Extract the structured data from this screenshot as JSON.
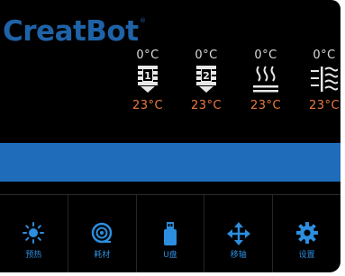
{
  "brand": {
    "logo_text": "CreatBot",
    "reg_mark": "®"
  },
  "temperatures": [
    {
      "id": "extruder-1",
      "icon": "nozzle-1-icon",
      "target": "0°C",
      "current": "23°C",
      "badge": "1"
    },
    {
      "id": "extruder-2",
      "icon": "nozzle-2-icon",
      "target": "0°C",
      "current": "23°C",
      "badge": "2"
    },
    {
      "id": "heated-bed",
      "icon": "heated-bed-icon",
      "target": "0°C",
      "current": "23°C"
    },
    {
      "id": "chamber",
      "icon": "chamber-heat-icon",
      "target": "0°C",
      "current": "23°C"
    }
  ],
  "status_bar": {
    "text": ""
  },
  "menu": [
    {
      "id": "preheat",
      "label": "预热",
      "icon": "sun-icon"
    },
    {
      "id": "filament",
      "label": "耗材",
      "icon": "filament-spool-icon"
    },
    {
      "id": "usb",
      "label": "U盘",
      "icon": "usb-drive-icon"
    },
    {
      "id": "move",
      "label": "移轴",
      "icon": "move-arrows-icon"
    },
    {
      "id": "settings",
      "label": "设置",
      "icon": "gear-icon"
    }
  ],
  "colors": {
    "background": "#000000",
    "brand_blue": "#1e63a8",
    "status_bar": "#1f6cba",
    "current_temp": "#ef7b3f",
    "target_temp": "#dcdcdc",
    "menu_icon": "#2c8ede"
  }
}
